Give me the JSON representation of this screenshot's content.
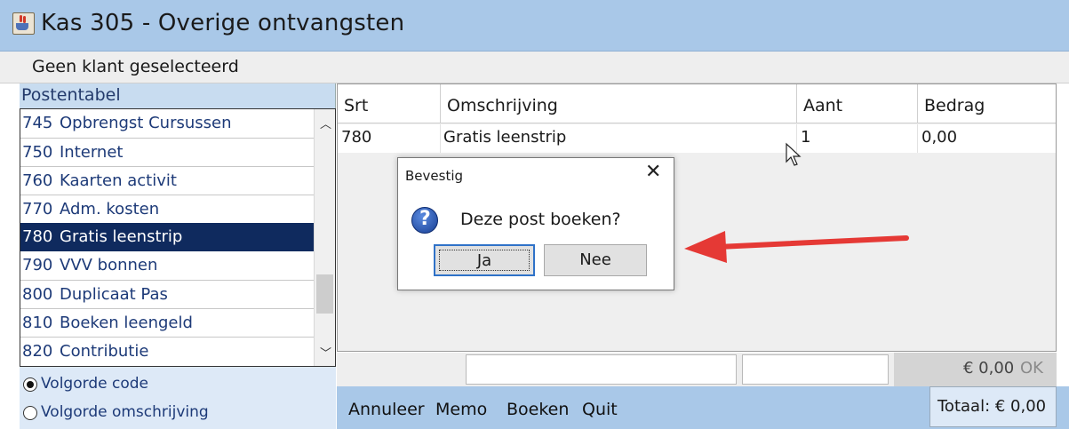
{
  "window": {
    "title": "Kas 305 - Overige ontvangsten",
    "icon": "java-app-icon"
  },
  "client_bar": {
    "text": "Geen klant geselecteerd"
  },
  "left_panel": {
    "header": "Postentabel",
    "items": [
      {
        "code": "745",
        "name": "Opbrengst Cursussen",
        "selected": false
      },
      {
        "code": "750",
        "name": "Internet",
        "selected": false
      },
      {
        "code": "760",
        "name": "Kaarten activit",
        "selected": false
      },
      {
        "code": "770",
        "name": "Adm. kosten",
        "selected": false
      },
      {
        "code": "780",
        "name": "Gratis leenstrip",
        "selected": true
      },
      {
        "code": "790",
        "name": "VVV bonnen",
        "selected": false
      },
      {
        "code": "800",
        "name": "Duplicaat Pas",
        "selected": false
      },
      {
        "code": "810",
        "name": "Boeken leengeld",
        "selected": false
      },
      {
        "code": "820",
        "name": "Contributie",
        "selected": false
      }
    ],
    "radios": [
      {
        "label": "Volgorde code",
        "checked": true
      },
      {
        "label": "Volgorde omschrijving",
        "checked": false
      }
    ]
  },
  "table": {
    "columns": [
      "Srt",
      "Omschrijving",
      "Aant",
      "Bedrag"
    ],
    "rows": [
      {
        "srt": "780",
        "omschrijving": "Gratis leenstrip",
        "aant": "1",
        "bedrag": "0,00"
      }
    ]
  },
  "input_row": {
    "amount": "€ 0,00",
    "ok_label": "OK"
  },
  "actions": {
    "annuleer": "Annuleer",
    "memo": "Memo",
    "boeken": "Boeken",
    "quit": "Quit",
    "total": "Totaal: € 0,00"
  },
  "dialog": {
    "title": "Bevestig",
    "close": "✕",
    "message": "Deze post boeken?",
    "yes": "Ja",
    "no": "Nee",
    "icon": "question-icon"
  },
  "colors": {
    "title_bar": "#a9c8e8",
    "selection": "#0f2a5e",
    "arrow": "#e53935",
    "panel": "#dde9f7"
  }
}
